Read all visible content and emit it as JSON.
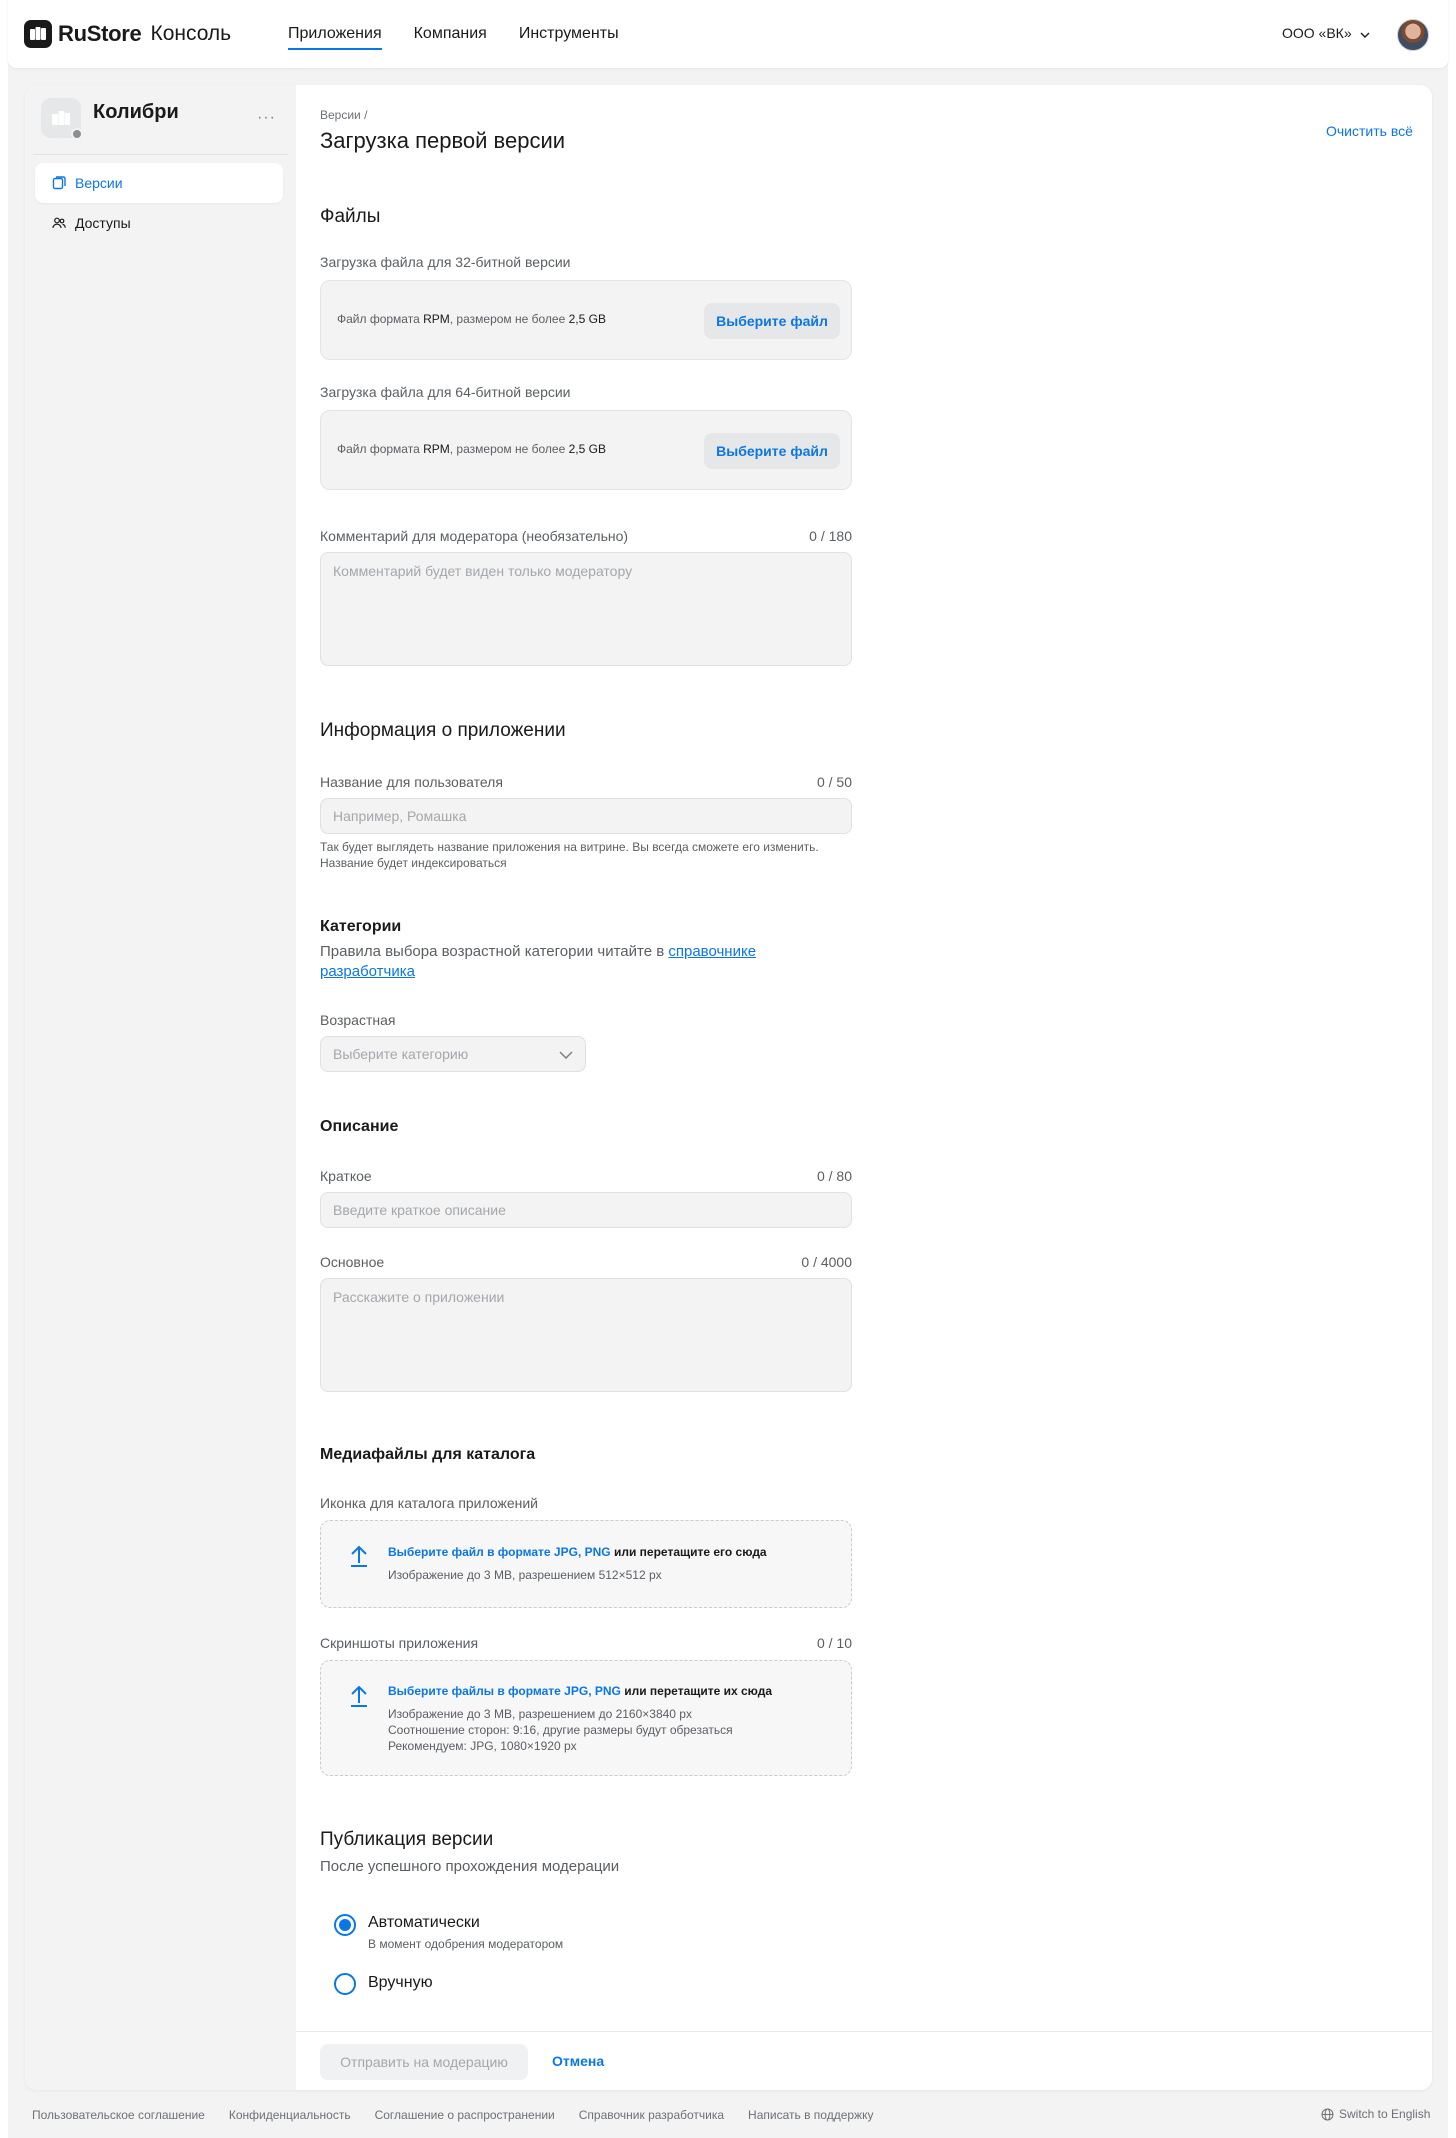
{
  "header": {
    "brand": "RuStore",
    "brand_sub": "Консоль",
    "nav": [
      "Приложения",
      "Компания",
      "Инструменты"
    ],
    "org": "ООО «ВК»"
  },
  "sidebar": {
    "app_name": "Колибри",
    "more": "···",
    "items": [
      {
        "label": "Версии",
        "icon": "versions-icon",
        "active": true
      },
      {
        "label": "Доступы",
        "icon": "users-icon",
        "active": false
      }
    ]
  },
  "page": {
    "breadcrumb": "Версии  /",
    "title": "Загрузка первой версии",
    "clear_all": "Очистить всё"
  },
  "files": {
    "heading": "Файлы",
    "file32_label": "Загрузка файла для 32-битной версии",
    "file64_label": "Загрузка файла для 64-битной версии",
    "desc_prefix": "Файл формата ",
    "desc_format": "RPM",
    "desc_mid": ", размером не более ",
    "desc_size": "2,5 GB",
    "choose_file": "Выберите файл",
    "comment_label": "Комментарий для модератора (необязательно)",
    "comment_counter": "0 / 180",
    "comment_placeholder": "Комментарий будет виден только модератору"
  },
  "info": {
    "heading": "Информация о приложении",
    "name_label": "Название для пользователя",
    "name_counter": "0 / 50",
    "name_placeholder": "Например, Ромашка",
    "name_hint": "Так будет выглядеть название приложения на витрине. Вы всегда сможете его изменить. Название будет индексироваться",
    "categories_heading": "Категории",
    "categories_text": "Правила выбора возрастной категории читайте в ",
    "categories_link": "справочнике разработчика",
    "age_label": "Возрастная",
    "age_placeholder": "Выберите категорию"
  },
  "description": {
    "heading": "Описание",
    "short_label": "Краткое",
    "short_counter": "0 / 80",
    "short_placeholder": "Введите краткое описание",
    "main_label": "Основное",
    "main_counter": "0 / 4000",
    "main_placeholder": "Расскажите о приложении"
  },
  "media": {
    "heading": "Медиафайлы для каталога",
    "icon_label": "Иконка для каталога приложений",
    "icon_choose": "Выберите файл в формате JPG, PNG",
    "icon_drop": " или перетащите его сюда",
    "icon_req": "Изображение до 3 MB, разрешением 512×512 px",
    "shots_label": "Скриншоты приложения",
    "shots_counter": "0 / 10",
    "shots_choose": "Выберите файлы в формате JPG, PNG",
    "shots_drop": " или перетащите их сюда",
    "shots_req1": "Изображение до 3 MB, разрешением до 2160×3840 px",
    "shots_req2": "Соотношение сторон: 9:16, другие размеры будут обрезаться",
    "shots_req3": "Рекомендуем: JPG, 1080×1920 px"
  },
  "publish": {
    "heading": "Публикация версии",
    "subtitle": "После успешного прохождения модерации",
    "auto_label": "Автоматически",
    "auto_hint": "В момент одобрения модератором",
    "manual_label": "Вручную",
    "selected": "auto"
  },
  "actions": {
    "submit": "Отправить на модерацию",
    "cancel": "Отмена"
  },
  "footer": {
    "links": [
      "Пользовательское соглашение",
      "Конфиденциальность",
      "Соглашение о распространении",
      "Справочник разработчика",
      "Написать в поддержку"
    ],
    "switch_lang": "Switch to English"
  },
  "colors": {
    "accent": "#0a77e6",
    "background": "#f3f3f4"
  }
}
